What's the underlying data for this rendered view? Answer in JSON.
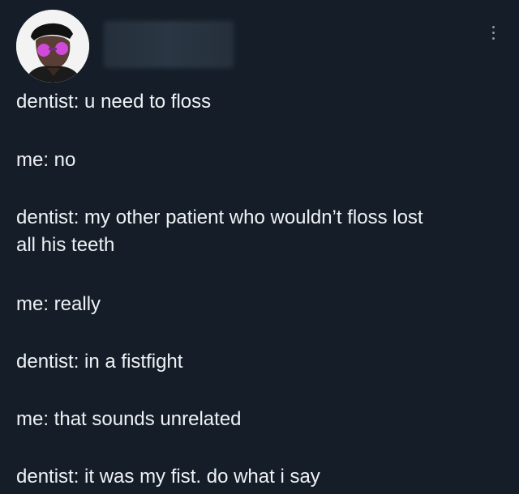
{
  "header": {
    "more_icon": "more-vertical-icon"
  },
  "tweet": {
    "lines": [
      "dentist: u need to floss",
      "me: no",
      "dentist: my other patient who wouldn’t floss lost",
      "all his teeth",
      "me: really",
      "dentist: in a fistfight",
      "me: that sounds unrelated",
      "dentist: it was my fist. do what i say"
    ]
  },
  "colors": {
    "background": "#151e28",
    "text": "#eef2f5",
    "icon": "#8b98a5"
  }
}
